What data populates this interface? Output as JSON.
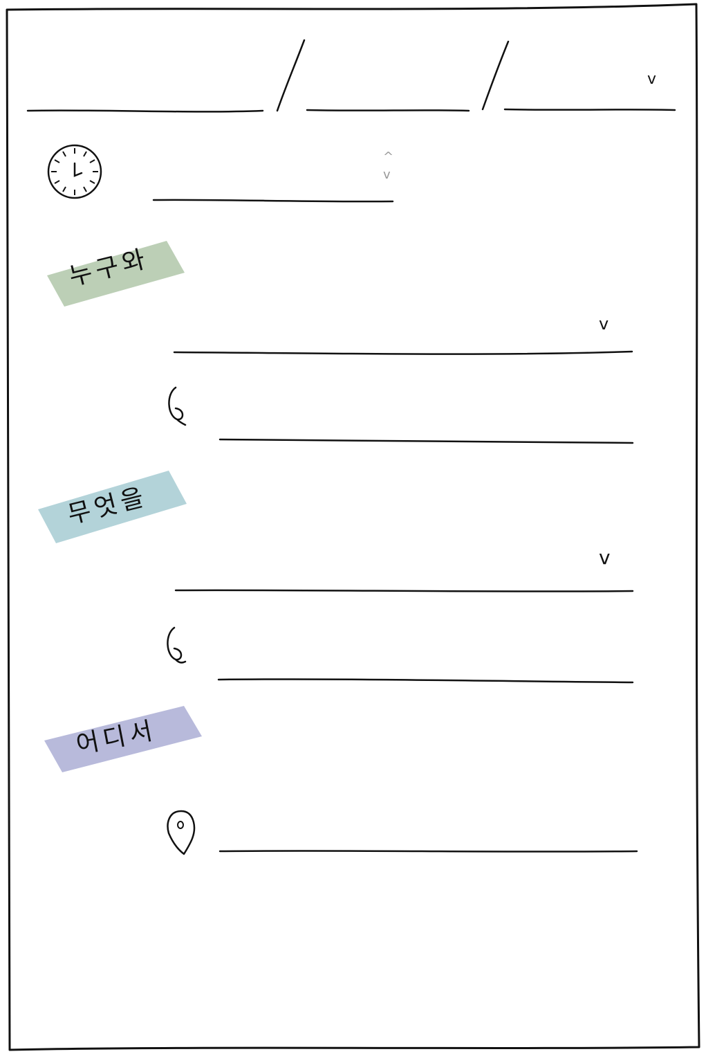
{
  "sections": {
    "who": {
      "label": "누구와",
      "color": "#bccfb6"
    },
    "what": {
      "label": "무엇을",
      "color": "#b3d3d9"
    },
    "where": {
      "label": "어디서",
      "color": "#b8badb"
    }
  },
  "icons": {
    "time": "clock-icon",
    "note": "pen-icon",
    "location": "map-pin-icon",
    "dropdown": "chevron-down-icon",
    "spinner": "spinner-arrows-icon"
  }
}
